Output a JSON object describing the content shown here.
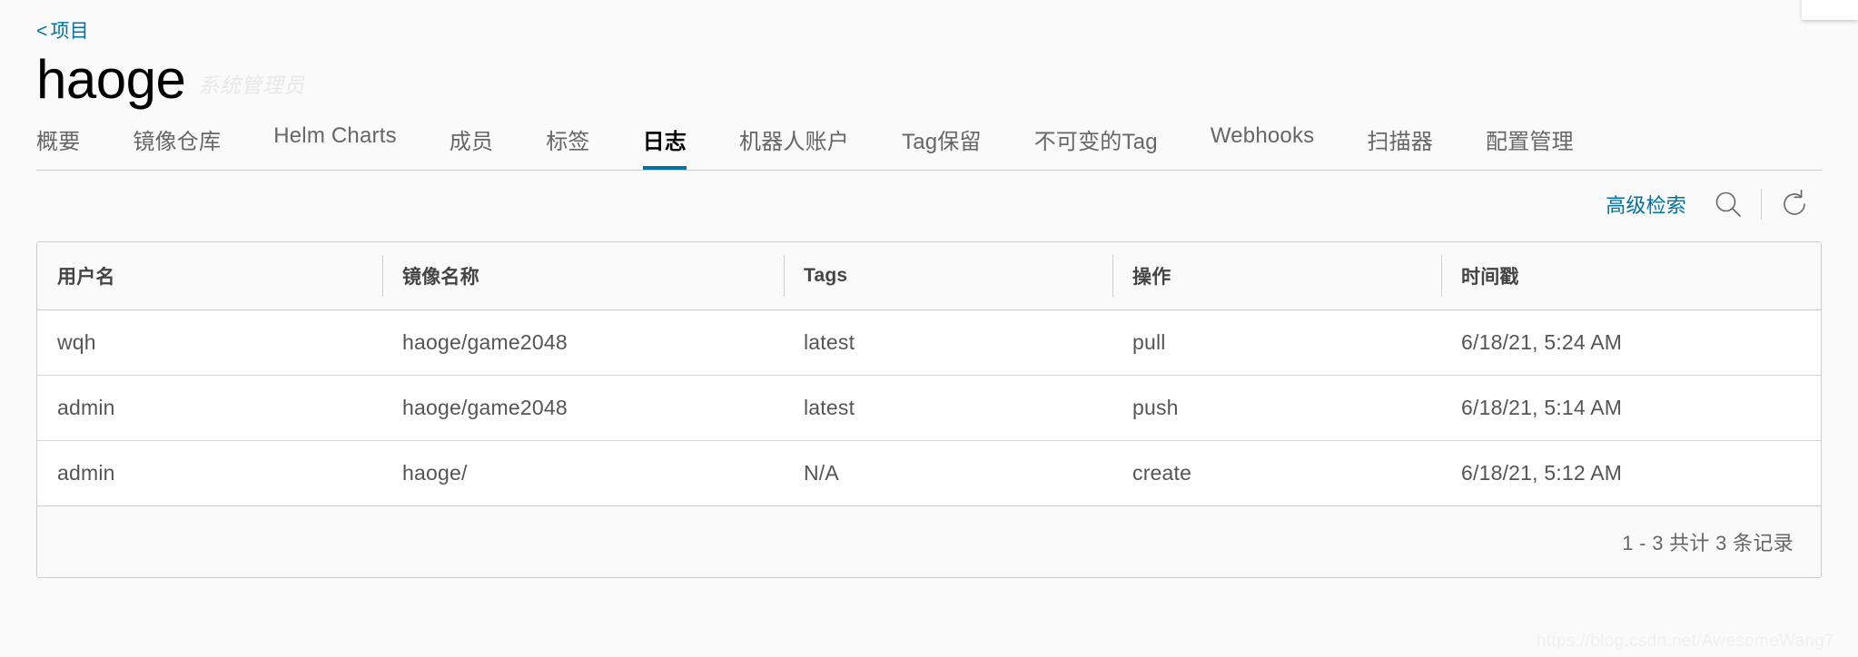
{
  "colors": {
    "accent": "#0072a3",
    "text_primary": "#000000",
    "text_secondary": "#666666",
    "border": "#cccccc",
    "header_bg": "#fafafa"
  },
  "breadcrumb": {
    "chevron": "<",
    "label": "项目"
  },
  "header": {
    "title": "haoge",
    "role": "系统管理员"
  },
  "tabs": [
    {
      "label": "概要",
      "active": false
    },
    {
      "label": "镜像仓库",
      "active": false
    },
    {
      "label": "Helm Charts",
      "active": false
    },
    {
      "label": "成员",
      "active": false
    },
    {
      "label": "标签",
      "active": false
    },
    {
      "label": "日志",
      "active": true
    },
    {
      "label": "机器人账户",
      "active": false
    },
    {
      "label": "Tag保留",
      "active": false
    },
    {
      "label": "不可变的Tag",
      "active": false
    },
    {
      "label": "Webhooks",
      "active": false
    },
    {
      "label": "扫描器",
      "active": false
    },
    {
      "label": "配置管理",
      "active": false
    }
  ],
  "toolbar": {
    "advanced_search_label": "高级检索",
    "search_icon": "search-icon",
    "refresh_icon": "refresh-icon"
  },
  "table": {
    "columns": [
      "用户名",
      "镜像名称",
      "Tags",
      "操作",
      "时间戳"
    ],
    "rows": [
      {
        "user": "wqh",
        "repo": "haoge/game2048",
        "tags": "latest",
        "operation": "pull",
        "timestamp": "6/18/21, 5:24 AM"
      },
      {
        "user": "admin",
        "repo": "haoge/game2048",
        "tags": "latest",
        "operation": "push",
        "timestamp": "6/18/21, 5:14 AM"
      },
      {
        "user": "admin",
        "repo": "haoge/",
        "tags": "N/A",
        "operation": "create",
        "timestamp": "6/18/21, 5:12 AM"
      }
    ],
    "pagination": "1 - 3 共计 3 条记录"
  },
  "watermark": "https://blog.csdn.net/AwesomeWang7"
}
